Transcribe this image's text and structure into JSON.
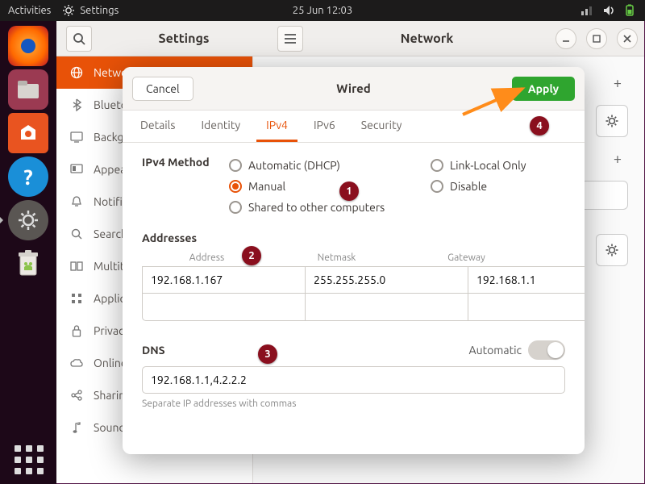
{
  "topbar": {
    "activities": "Activities",
    "app_label": "Settings",
    "datetime": "25 Jun  12:03"
  },
  "window": {
    "title_left": "Settings",
    "title_right": "Network"
  },
  "sidebar": {
    "items": [
      {
        "label": "Network"
      },
      {
        "label": "Bluetooth"
      },
      {
        "label": "Background"
      },
      {
        "label": "Appearance"
      },
      {
        "label": "Notifications"
      },
      {
        "label": "Search"
      },
      {
        "label": "Multitasking"
      },
      {
        "label": "Applications"
      },
      {
        "label": "Privacy"
      },
      {
        "label": "Online Accounts"
      },
      {
        "label": "Sharing"
      },
      {
        "label": "Sound"
      }
    ]
  },
  "dialog": {
    "cancel": "Cancel",
    "title": "Wired",
    "apply": "Apply",
    "tabs": {
      "details": "Details",
      "identity": "Identity",
      "ipv4": "IPv4",
      "ipv6": "IPv6",
      "security": "Security"
    },
    "method_label": "IPv4 Method",
    "methods": {
      "dhcp": "Automatic (DHCP)",
      "linklocal": "Link-Local Only",
      "manual": "Manual",
      "disable": "Disable",
      "shared": "Shared to other computers"
    },
    "addresses_label": "Addresses",
    "addr_headers": {
      "address": "Address",
      "netmask": "Netmask",
      "gateway": "Gateway"
    },
    "addr_rows": [
      {
        "address": "192.168.1.167",
        "netmask": "255.255.255.0",
        "gateway": "192.168.1.1"
      },
      {
        "address": "",
        "netmask": "",
        "gateway": ""
      }
    ],
    "dns_label": "DNS",
    "dns_auto": "Automatic",
    "dns_value": "192.168.1.1,4.2.2.2",
    "dns_hint": "Separate IP addresses with commas"
  },
  "badges": {
    "b1": "1",
    "b2": "2",
    "b3": "3",
    "b4": "4"
  }
}
